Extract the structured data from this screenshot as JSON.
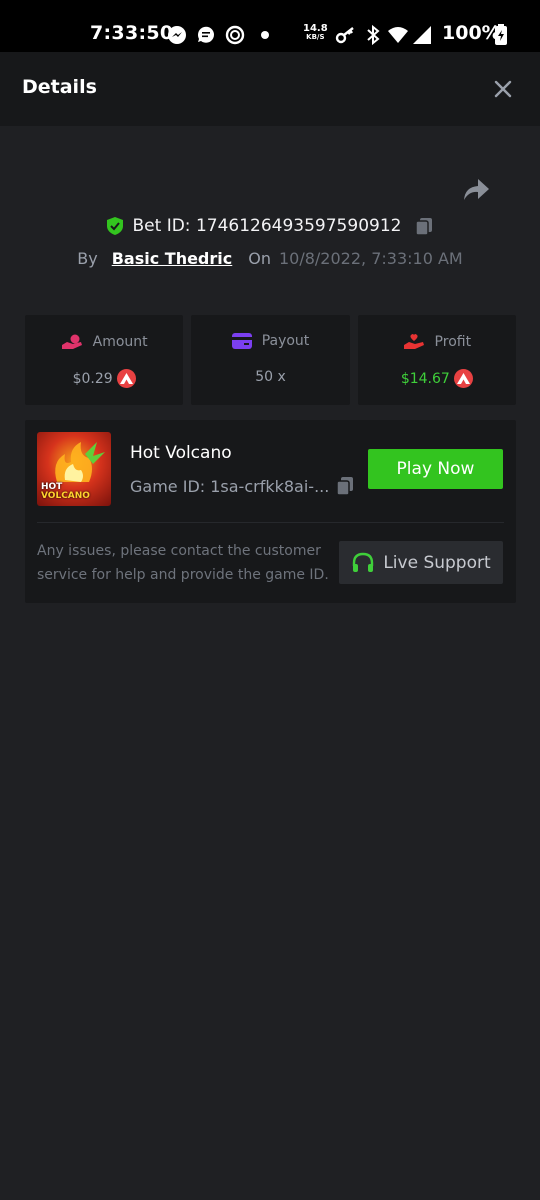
{
  "status_bar": {
    "time": "7:33:50",
    "speed_value": "14.8",
    "speed_unit": "KB/S",
    "battery": "100%"
  },
  "header": {
    "title": "Details"
  },
  "bet": {
    "bet_id_label": "Bet ID:",
    "bet_id": "1746126493597590912",
    "by_label": "By",
    "user": "Basic Thedric",
    "on_label": "On",
    "date": "10/8/2022, 7:33:10 AM"
  },
  "stats": [
    {
      "label": "Amount",
      "value": "$0.29",
      "icon": "hand-coin-icon",
      "icon_color": "#e0336b",
      "has_coin": true
    },
    {
      "label": "Payout",
      "value": "50 x",
      "icon": "card-icon",
      "icon_color": "#7b3ff0",
      "has_coin": false
    },
    {
      "label": "Profit",
      "value": "$14.67",
      "icon": "hand-heart-icon",
      "icon_color": "#e83333",
      "has_coin": true,
      "value_color": "#3fcf3a"
    }
  ],
  "game": {
    "name": "Hot Volcano",
    "game_id": "Game ID: 1sa-crfkk8ai-...",
    "play_label": "Play Now",
    "thumbnail_line1": "HOT",
    "thumbnail_line2": "VOLCANO",
    "issue_text": "Any issues, please contact the customer service for help and provide the game ID.",
    "support_label": "Live Support"
  },
  "colors": {
    "background": "#1f2023",
    "card": "#17181a",
    "accent_green": "#33c41f",
    "avax_red": "#e84142"
  }
}
